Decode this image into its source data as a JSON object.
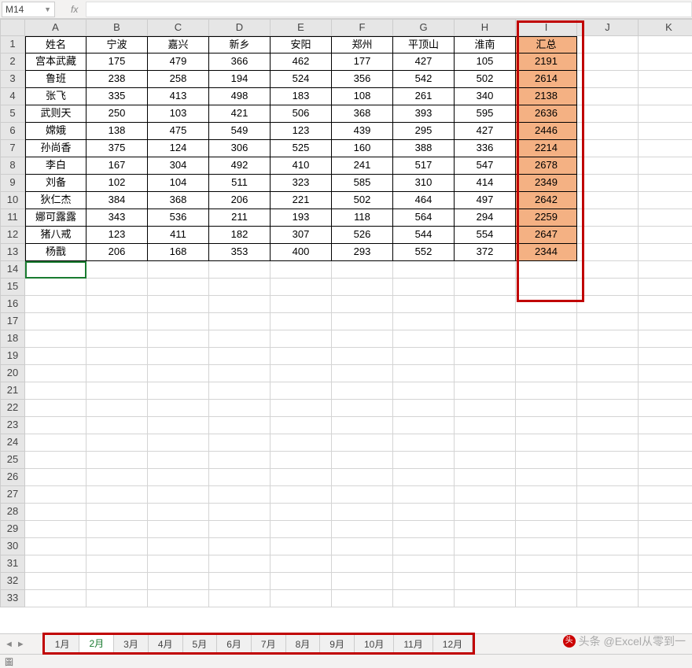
{
  "name_box": "M14",
  "fx_label": "fx",
  "columns": [
    "A",
    "B",
    "C",
    "D",
    "E",
    "F",
    "G",
    "H",
    "I",
    "J",
    "K"
  ],
  "row_count": 33,
  "active_cell": {
    "row": 14,
    "col": 0
  },
  "headers": [
    "姓名",
    "宁波",
    "嘉兴",
    "新乡",
    "安阳",
    "郑州",
    "平顶山",
    "淮南",
    "汇总"
  ],
  "data_rows": [
    [
      "宫本武藏",
      175,
      479,
      366,
      462,
      177,
      427,
      105,
      2191
    ],
    [
      "鲁班",
      238,
      258,
      194,
      524,
      356,
      542,
      502,
      2614
    ],
    [
      "张飞",
      335,
      413,
      498,
      183,
      108,
      261,
      340,
      2138
    ],
    [
      "武则天",
      250,
      103,
      421,
      506,
      368,
      393,
      595,
      2636
    ],
    [
      "嫦娥",
      138,
      475,
      549,
      123,
      439,
      295,
      427,
      2446
    ],
    [
      "孙尚香",
      375,
      124,
      306,
      525,
      160,
      388,
      336,
      2214
    ],
    [
      "李白",
      167,
      304,
      492,
      410,
      241,
      517,
      547,
      2678
    ],
    [
      "刘备",
      102,
      104,
      511,
      323,
      585,
      310,
      414,
      2349
    ],
    [
      "狄仁杰",
      384,
      368,
      206,
      221,
      502,
      464,
      497,
      2642
    ],
    [
      "娜可露露",
      343,
      536,
      211,
      193,
      118,
      564,
      294,
      2259
    ],
    [
      "猪八戒",
      123,
      411,
      182,
      307,
      526,
      544,
      554,
      2647
    ],
    [
      "杨戬",
      206,
      168,
      353,
      400,
      293,
      552,
      372,
      2344
    ]
  ],
  "highlight_col_index": 8,
  "tabs": [
    "1月",
    "2月",
    "3月",
    "4月",
    "5月",
    "6月",
    "7月",
    "8月",
    "9月",
    "10月",
    "11月",
    "12月"
  ],
  "active_tab": "2月",
  "watermark": "头条 @Excel从零到一",
  "status_icon": "圖"
}
